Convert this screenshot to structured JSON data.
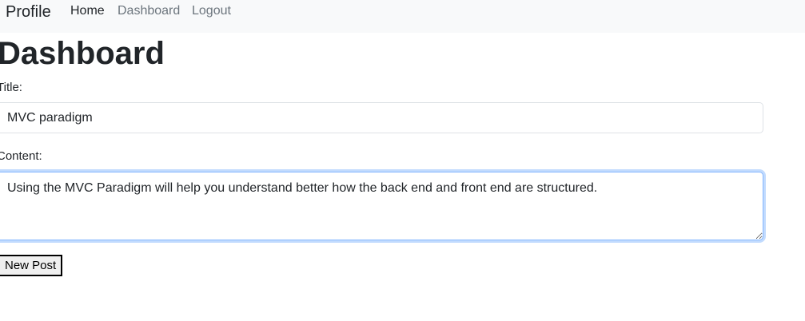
{
  "navbar": {
    "brand": "Profile",
    "links": [
      {
        "label": "Home"
      },
      {
        "label": "Dashboard"
      },
      {
        "label": "Logout"
      }
    ]
  },
  "page": {
    "title": "Dashboard"
  },
  "form": {
    "title_label": "Title:",
    "title_value": "MVC paradigm",
    "content_label": "Content:",
    "content_value": "Using the MVC Paradigm will help you understand better how the back end and front end are structured.",
    "submit_label": "New Post"
  },
  "colors": {
    "navbar_bg": "#f8f9fa",
    "text": "#212529",
    "muted_link": "#6c757d",
    "focus_border": "#86b7fe"
  }
}
